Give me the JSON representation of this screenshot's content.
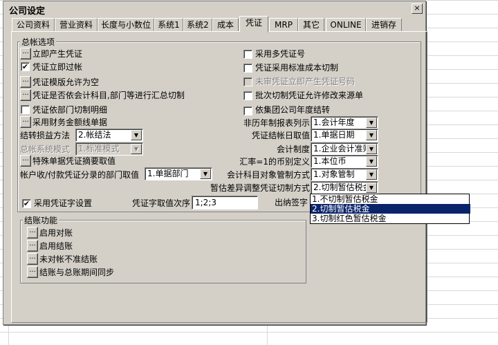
{
  "dialog": {
    "title": "公司设定",
    "close_label": "×"
  },
  "tabs": [
    "公司资料",
    "营业资料",
    "长度与小数位",
    "系统1",
    "系统2",
    "成本",
    "凭证",
    "MRP",
    "其它",
    "ONLINE",
    "进销存"
  ],
  "general": {
    "legend": "总帐选项",
    "left_options": [
      {
        "label": "立即产生凭证",
        "control": "button"
      },
      {
        "label": "凭证立即过帐",
        "control": "checkbox",
        "checked": true
      },
      {
        "label": "凭证模版允许为空",
        "control": "button"
      },
      {
        "label": "凭证是否依会计科目,部门等进行汇总切制",
        "control": "button"
      },
      {
        "label": "凭证依部门切制明细",
        "control": "checkbox",
        "checked": false
      },
      {
        "label": "采用财务金额线单据",
        "control": "button"
      }
    ],
    "right_options": [
      {
        "label": "采用多凭证号",
        "checked": false,
        "disabled": false
      },
      {
        "label": "凭证采用标准成本切制",
        "checked": false,
        "disabled": false
      },
      {
        "label": "未审凭证立即产生凭证号码",
        "checked": false,
        "disabled": true
      },
      {
        "label": "批次切制凭证允许修改来源单",
        "checked": false,
        "disabled": false
      },
      {
        "label": "依集团公司年度结转",
        "checked": false,
        "disabled": false
      }
    ],
    "pl_method": {
      "label": "结转损益方法",
      "value": "2.帐结法"
    },
    "ledger_mode": {
      "label": "总帐系统模式",
      "value": "1.标准模式"
    },
    "special_summary": {
      "label": "特殊单据凭证摘要取值"
    },
    "dept_value": {
      "label": "帐户收/付款凭证分录的部门取值",
      "value": "1.单据部门"
    },
    "right_combos": [
      {
        "label": "非历年制报表列示",
        "value": "1.会计年度"
      },
      {
        "label": "凭证结帐日取值",
        "value": "1.单据日期"
      },
      {
        "label": "会计制度",
        "value": "1.企业会计准则"
      },
      {
        "label": "汇率=1的币别定义",
        "value": "1.本位币"
      },
      {
        "label": "会计科目对象管制方式",
        "value": "1.对象管制"
      },
      {
        "label": "暂估差异调整凭证切制方式",
        "value": "2.切制暂估税金"
      }
    ],
    "voucher_word": {
      "label": "采用凭证字设置",
      "checked": true
    },
    "voucher_order": {
      "label": "凭证字取值次序",
      "value": "1;2;3"
    },
    "cashier": {
      "label": "出纳签字"
    }
  },
  "close_group": {
    "legend": "结账功能",
    "items": [
      "启用对账",
      "启用结账",
      "未对帐不准结账",
      "结账与总账期间同步"
    ]
  },
  "dropdown": {
    "options": [
      "1.不切制暂估税金",
      "2.切制暂估税金",
      "3.切制红色暂估税金"
    ],
    "selected_index": 1
  },
  "glyphs": {
    "dots": "...",
    "check": "✔",
    "arrow": "▼"
  }
}
